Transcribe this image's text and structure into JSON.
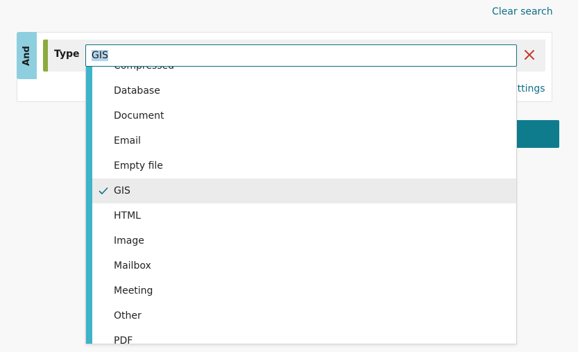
{
  "header": {
    "clear_search_label": "Clear search"
  },
  "query": {
    "operator_label": "And",
    "condition": {
      "field_label": "Type",
      "input_value": "GIS"
    },
    "settings_link_label": "ettings"
  },
  "dropdown": {
    "selected_value": "GIS",
    "options": [
      "Compressed",
      "Database",
      "Document",
      "Email",
      "Empty file",
      "GIS",
      "HTML",
      "Image",
      "Mailbox",
      "Meeting",
      "Other",
      "PDF"
    ]
  },
  "colors": {
    "link": "#0f6f86",
    "operator_tab": "#8ecfdf",
    "condition_bar": "#8bab3e",
    "dropdown_accent": "#3db4c9",
    "remove_icon": "#c0392b",
    "primary_button": "#0f7c8e"
  },
  "icons": {
    "remove": "close-icon",
    "selected": "check-icon"
  }
}
